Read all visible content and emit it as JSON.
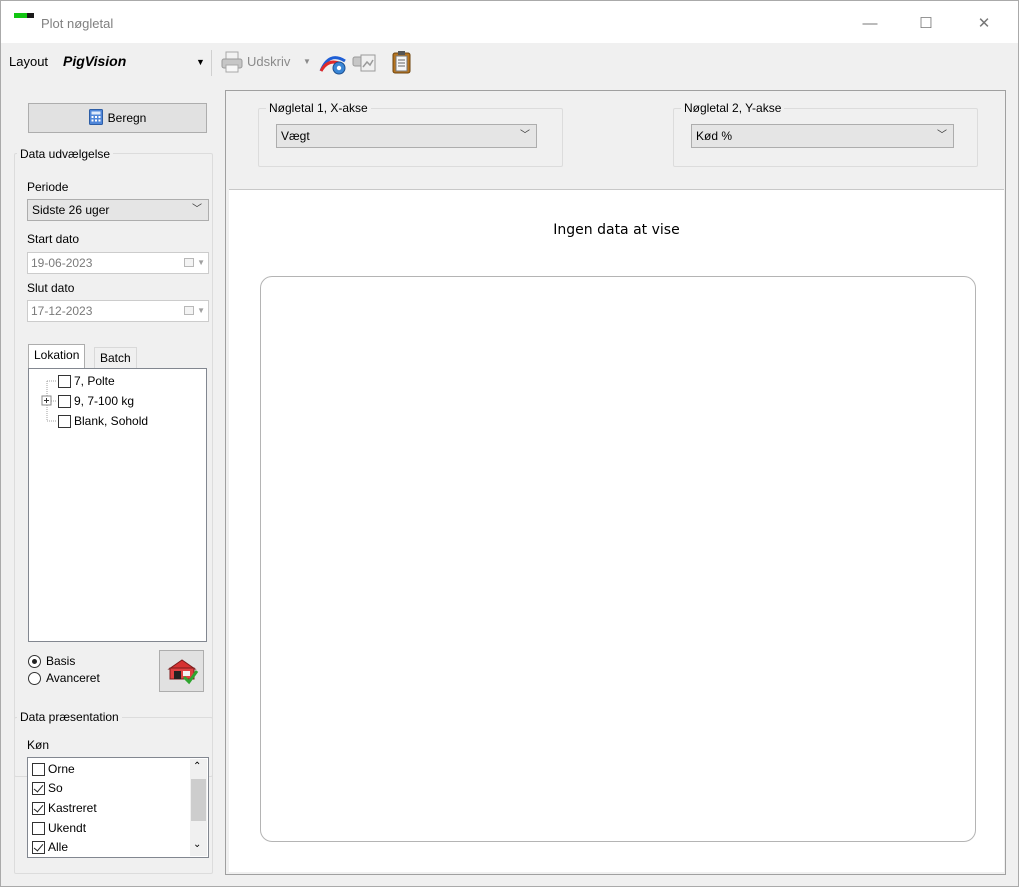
{
  "window": {
    "title": "Plot nøgletal",
    "controls": {
      "minimize": "—",
      "maximize": "☐",
      "close": "✕"
    }
  },
  "toolbar": {
    "layout_label": "Layout",
    "layout_value": "PigVision",
    "print_label": "Udskriv",
    "icons": [
      "printer-icon",
      "chart-settings-icon",
      "print-preview-icon",
      "clipboard-icon"
    ]
  },
  "left": {
    "calc_button": "Beregn",
    "data_selection": {
      "title": "Data udvælgelse",
      "period_label": "Periode",
      "period_value": "Sidste 26 uger",
      "start_label": "Start dato",
      "start_value": "19-06-2023",
      "end_label": "Slut dato",
      "end_value": "17-12-2023"
    },
    "tabs": [
      {
        "label": "Lokation",
        "active": true
      },
      {
        "label": "Batch",
        "active": false
      }
    ],
    "tree": [
      {
        "label": "7, Polte",
        "expandable": false,
        "checked": false
      },
      {
        "label": "9, 7-100 kg",
        "expandable": true,
        "checked": false
      },
      {
        "label": "Blank, Sohold",
        "expandable": false,
        "checked": false
      }
    ],
    "mode": [
      {
        "label": "Basis",
        "selected": true
      },
      {
        "label": "Avanceret",
        "selected": false
      }
    ],
    "presentation": {
      "title": "Data præsentation",
      "gender_label": "Køn",
      "genders": [
        {
          "label": "Orne",
          "checked": false
        },
        {
          "label": "So",
          "checked": true
        },
        {
          "label": "Kastreret",
          "checked": true
        },
        {
          "label": "Ukendt",
          "checked": false
        },
        {
          "label": "Alle",
          "checked": true
        }
      ]
    }
  },
  "main": {
    "x_axis": {
      "title": "Nøgletal 1, X-akse",
      "value": "Vægt"
    },
    "y_axis": {
      "title": "Nøgletal 2, Y-akse",
      "value": "Kød %"
    },
    "chart_message": "Ingen data at vise"
  },
  "colors": {
    "accent_green": "#12c512",
    "window_bg": "#f0f0f0"
  }
}
